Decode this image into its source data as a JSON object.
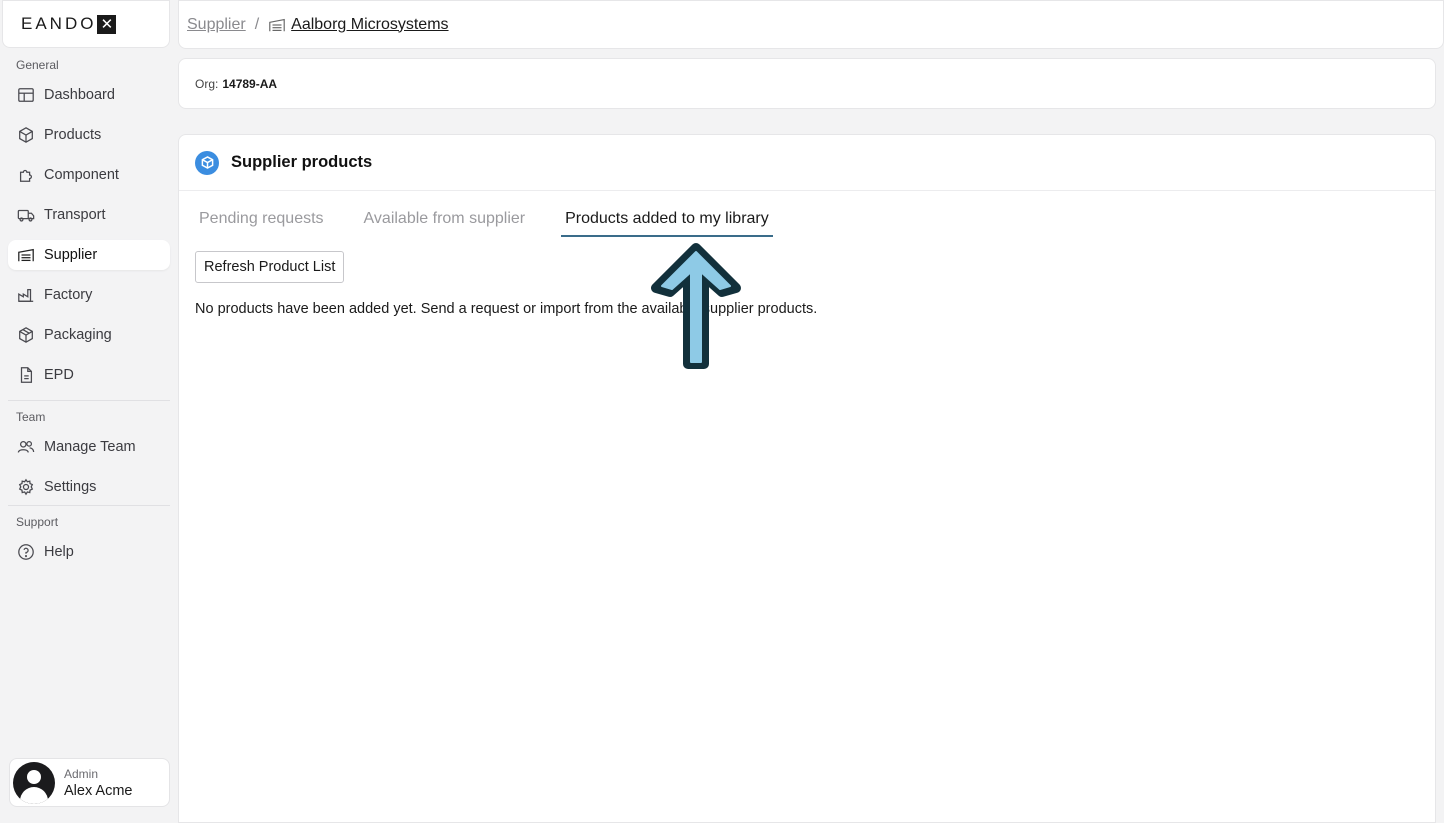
{
  "app": {
    "logo_text": "EANDO",
    "logo_mark": "✕"
  },
  "sidebar": {
    "sections": {
      "general": "General",
      "team": "Team",
      "support": "Support"
    },
    "items": [
      {
        "label": "Dashboard",
        "icon": "dashboard-icon"
      },
      {
        "label": "Products",
        "icon": "box-icon"
      },
      {
        "label": "Component",
        "icon": "puzzle-icon"
      },
      {
        "label": "Transport",
        "icon": "truck-icon"
      },
      {
        "label": "Supplier",
        "icon": "warehouse-icon",
        "active": true
      },
      {
        "label": "Factory",
        "icon": "factory-icon"
      },
      {
        "label": "Packaging",
        "icon": "package-icon"
      },
      {
        "label": "EPD",
        "icon": "document-icon"
      },
      {
        "label": "Manage Team",
        "icon": "users-icon"
      },
      {
        "label": "Settings",
        "icon": "gear-icon"
      },
      {
        "label": "Help",
        "icon": "help-icon"
      }
    ],
    "user": {
      "role": "Admin",
      "name": "Alex Acme"
    }
  },
  "breadcrumb": {
    "parent": "Supplier",
    "separator": "/",
    "current": "Aalborg Microsystems"
  },
  "org": {
    "label": "Org:",
    "value": "14789-AA"
  },
  "panel": {
    "title": "Supplier products",
    "tabs": [
      {
        "label": "Pending requests"
      },
      {
        "label": "Available from supplier"
      },
      {
        "label": "Products added to my library",
        "active": true
      }
    ],
    "refresh_label": "Refresh Product List",
    "empty_message": "No products have been added yet. Send a request or import from the available supplier products."
  },
  "colors": {
    "accent": "#3a6c8a",
    "panel_icon": "#3b8de0",
    "arrow_fill": "#8ecae6",
    "arrow_outline": "#12303b"
  }
}
